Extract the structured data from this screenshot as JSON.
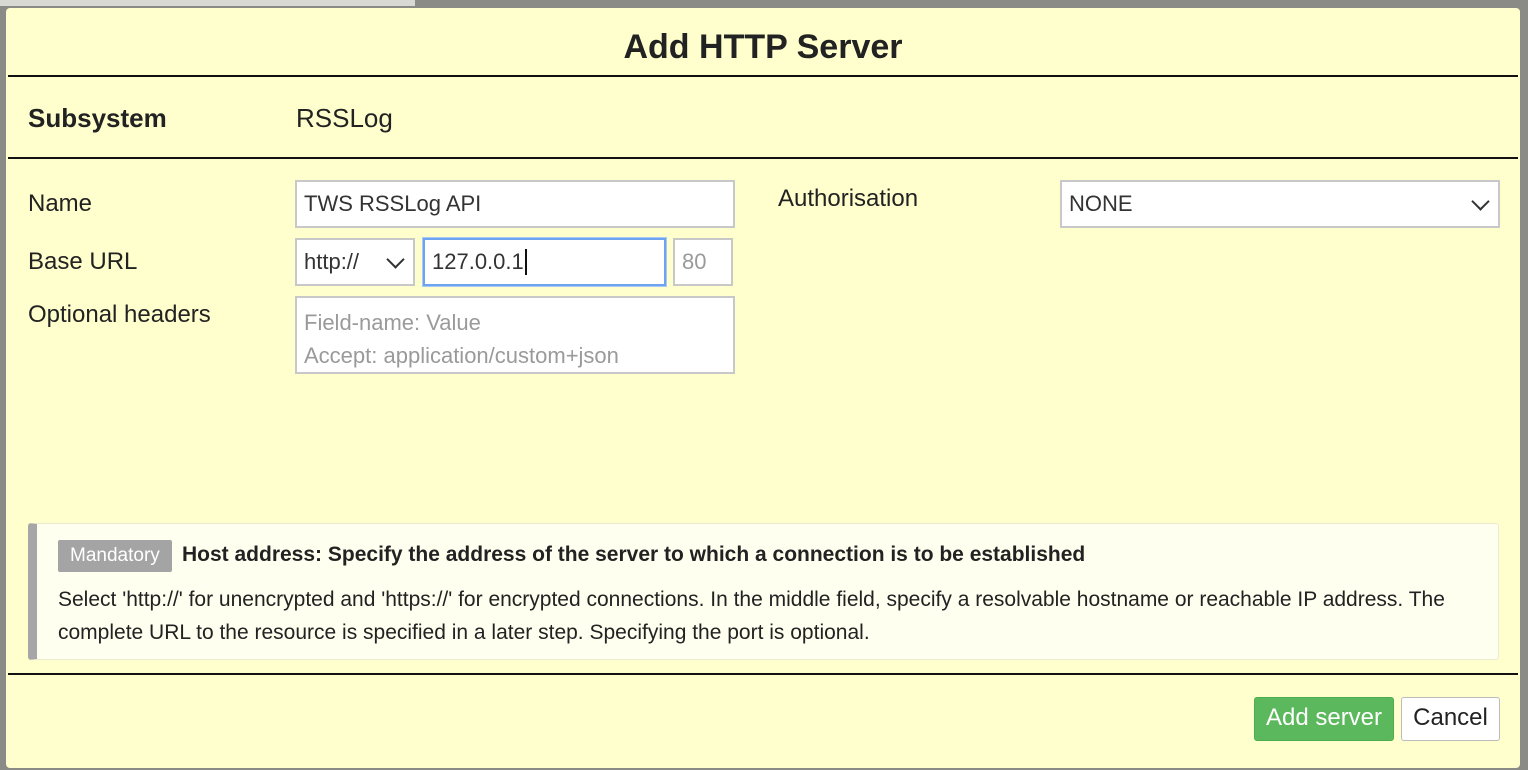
{
  "dialog": {
    "title": "Add HTTP Server"
  },
  "subsystem": {
    "label": "Subsystem",
    "value": "RSSLog"
  },
  "name": {
    "label": "Name",
    "value": "TWS RSSLog API"
  },
  "base_url": {
    "label": "Base URL",
    "scheme": "http://",
    "host": "127.0.0.1",
    "port_placeholder": "80"
  },
  "headers": {
    "label": "Optional headers",
    "placeholder_line1": "Field-name: Value",
    "placeholder_line2": "Accept: application/custom+json"
  },
  "authorisation": {
    "label": "Authorisation",
    "value": "NONE"
  },
  "help": {
    "badge": "Mandatory",
    "title": "Host address: Specify the address of the server to which a connection is to be established",
    "text": "Select 'http://' for unencrypted and 'https://' for encrypted connections. In the middle field, specify a resolvable hostname or reachable IP address. The complete URL to the resource is specified in a later step. Specifying the port is optional."
  },
  "buttons": {
    "add": "Add server",
    "cancel": "Cancel"
  },
  "colors": {
    "dialog_bg": "#ffffcd",
    "primary_button": "#5cb85c",
    "badge": "#a4a4a4"
  },
  "icons": {
    "select_arrow": "chevron-down-icon",
    "cursor": "text-caret"
  }
}
